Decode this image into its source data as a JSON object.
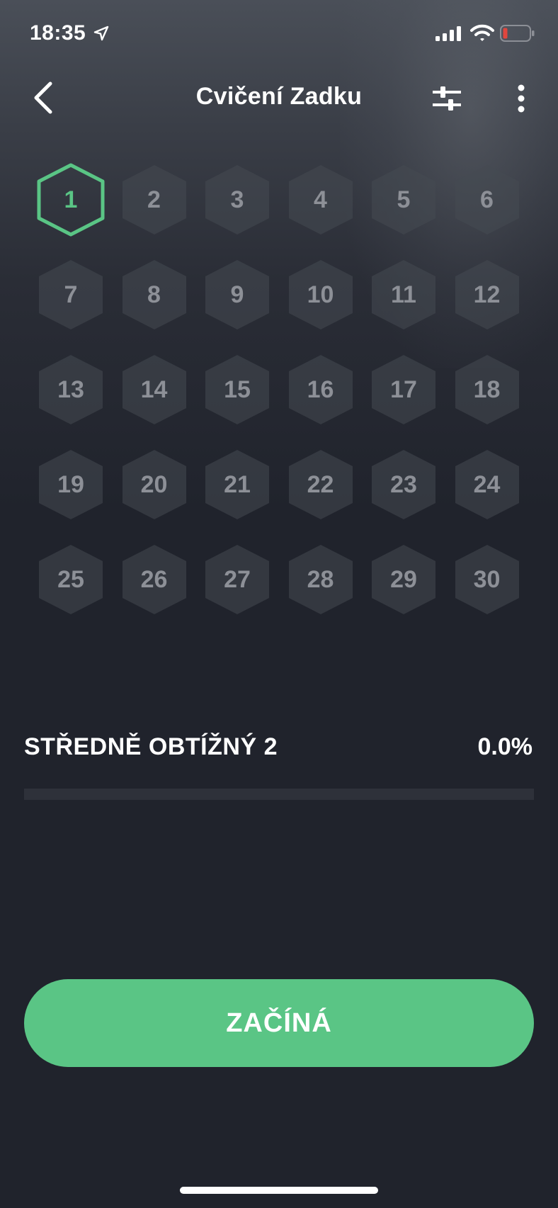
{
  "status_bar": {
    "time": "18:35"
  },
  "nav": {
    "title": "Cvičení Zadku"
  },
  "days": [
    "1",
    "2",
    "3",
    "4",
    "5",
    "6",
    "7",
    "8",
    "9",
    "10",
    "11",
    "12",
    "13",
    "14",
    "15",
    "16",
    "17",
    "18",
    "19",
    "20",
    "21",
    "22",
    "23",
    "24",
    "25",
    "26",
    "27",
    "28",
    "29",
    "30"
  ],
  "active_day": "1",
  "level": {
    "label": "STŘEDNĚ OBTÍŽNÝ 2",
    "percent_text": "0.0%",
    "progress": 0.0
  },
  "start_button": {
    "label": "ZAČÍNÁ"
  },
  "colors": {
    "accent": "#5ac585",
    "background": "#20232c",
    "hex_fill": "#464a52",
    "day_number": "#8d9097"
  },
  "icons": {
    "back": "chevron-left-icon",
    "filter": "sliders-icon",
    "more": "more-vertical-icon",
    "location": "location-arrow-icon",
    "signal": "cellular-signal-icon",
    "wifi": "wifi-icon",
    "battery": "battery-low-icon"
  }
}
